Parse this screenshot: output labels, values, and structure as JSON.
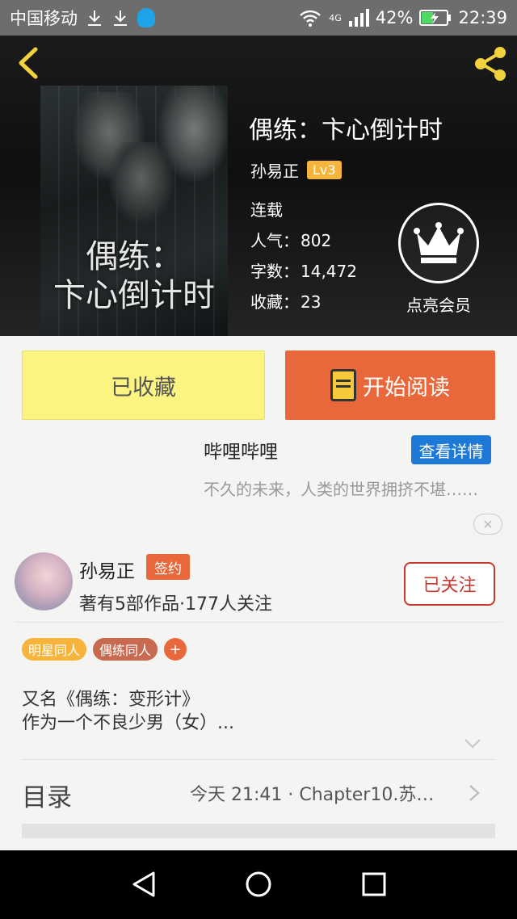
{
  "status_bar": {
    "carrier": "中国移动",
    "network": "4G",
    "battery": "42%",
    "time": "22:39"
  },
  "book": {
    "cover_title_line1": "偶练：",
    "cover_title_line2": "卞心倒计时",
    "title": "偶练：卞心倒计时",
    "author": "孙易正",
    "author_level": "Lv3",
    "status": "连载",
    "popularity_label": "人气：",
    "popularity": "802",
    "words_label": "字数：",
    "words": "14,472",
    "favorites_label": "收藏：",
    "favorites": "23"
  },
  "vip": {
    "label": "点亮会员"
  },
  "actions": {
    "collected_label": "已收藏",
    "read_label": "开始阅读"
  },
  "ad": {
    "title": "哔哩哔哩",
    "detail_button": "查看详情",
    "description": "不久的未来，人类的世界拥挤不堪……",
    "close_symbol": "✕"
  },
  "author_card": {
    "name": "孙易正",
    "badge": "签约",
    "meta": "著有5部作品·177人关注",
    "follow_label": "已关注"
  },
  "tags": [
    {
      "label": "明星同人",
      "color": "#f6b43d"
    },
    {
      "label": "偶练同人",
      "color": "#c86a50"
    }
  ],
  "tag_add_symbol": "+",
  "intro": {
    "line1": "又名《偶练：变形计》",
    "line2": "作为一个不良少男（女）..."
  },
  "toc": {
    "title": "目录",
    "latest": "今天 21:41 · Chapter10.苏…"
  }
}
